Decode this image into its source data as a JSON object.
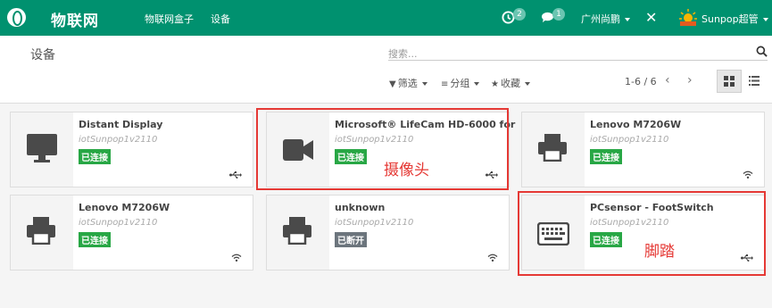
{
  "navbar": {
    "app_title": "物联网",
    "menu": [
      "物联网盒子",
      "设备"
    ],
    "activity_count": "2",
    "message_count": "1",
    "company": "广州尚鹏",
    "user": "Sunpop超管"
  },
  "control_panel": {
    "breadcrumb": "设备",
    "search_placeholder": "搜索...",
    "filters_label": "筛选",
    "groupby_label": "分组",
    "favorites_label": "收藏",
    "pager": "1-6 / 6"
  },
  "devices": [
    {
      "name": "Distant Display",
      "host": "iotSunpop1v2110",
      "status": "已连接",
      "status_kind": "connected",
      "type_icon": "monitor-icon",
      "connection_icon": "usb-icon"
    },
    {
      "name": "Microsoft® LifeCam HD-6000 for",
      "host": "iotSunpop1v2110",
      "status": "已连接",
      "status_kind": "connected",
      "type_icon": "camera-icon",
      "connection_icon": "usb-icon"
    },
    {
      "name": "Lenovo M7206W",
      "host": "iotSunpop1v2110",
      "status": "已连接",
      "status_kind": "connected",
      "type_icon": "printer-icon",
      "connection_icon": "wifi-icon"
    },
    {
      "name": "Lenovo M7206W",
      "host": "iotSunpop1v2110",
      "status": "已连接",
      "status_kind": "connected",
      "type_icon": "printer-icon",
      "connection_icon": "wifi-icon"
    },
    {
      "name": "unknown",
      "host": "iotSunpop1v2110",
      "status": "已断开",
      "status_kind": "disconnected",
      "type_icon": "printer-icon",
      "connection_icon": "wifi-icon"
    },
    {
      "name": "PCsensor - FootSwitch",
      "host": "iotSunpop1v2110",
      "status": "已连接",
      "status_kind": "connected",
      "type_icon": "keyboard-icon",
      "connection_icon": "usb-icon"
    }
  ],
  "annotations": [
    "摄像头",
    "脚踏"
  ],
  "colors": {
    "brand": "#00916f",
    "connected": "#28a745",
    "disconnected": "#6c757d",
    "annotation": "#e53935"
  }
}
